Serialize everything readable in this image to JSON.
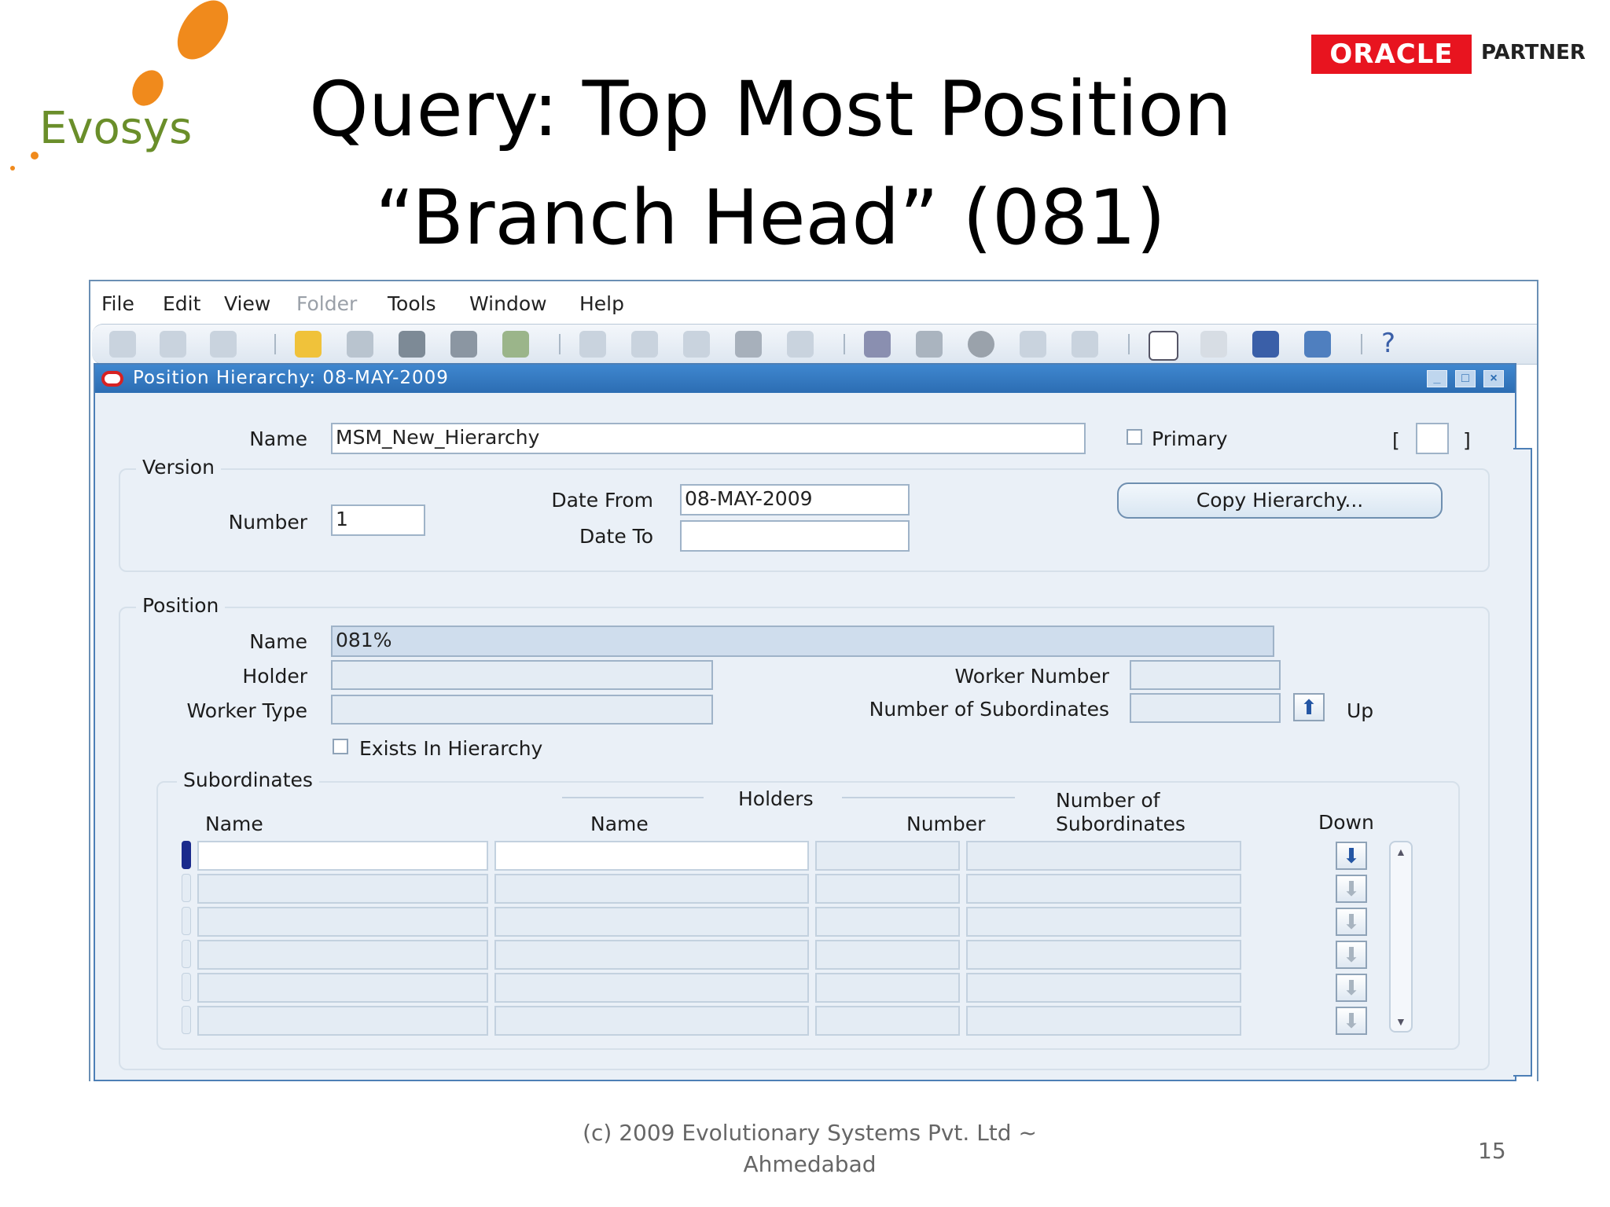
{
  "slide": {
    "title_line1": "Query: Top Most Position",
    "title_line2": "“Branch Head” (081)",
    "footer": "(c) 2009 Evolutionary Systems Pvt. Ltd ~ Ahmedabad",
    "page_number": "15",
    "logos": {
      "left": "Evosys",
      "right_brand": "ORACLE",
      "right_suffix": "PARTNER"
    }
  },
  "menu": [
    "File",
    "Edit",
    "View",
    "Folder",
    "Tools",
    "Window",
    "Help"
  ],
  "toolbar_icons": [
    "new-icon",
    "find-icon",
    "show-navigator-icon",
    "open-folder-icon",
    "save-icon",
    "next-step-icon",
    "print-icon",
    "close-form-icon",
    "cut-icon",
    "copy-icon",
    "paste-icon",
    "clear-record-icon",
    "delete-record-icon",
    "edit-field-icon",
    "zoom-icon",
    "translations-icon",
    "attachments-icon",
    "folder-tools-icon",
    "calendar-icon",
    "work-planner-icon",
    "window-export-icon",
    "help-docs-icon",
    "help-icon"
  ],
  "window": {
    "title": "Position Hierarchy: 08-MAY-2009",
    "name_label": "Name",
    "name_value": "MSM_New_Hierarchy",
    "primary_label": "Primary",
    "bracket_left": "[",
    "bracket_right": "]",
    "version": {
      "group_label": "Version",
      "number_label": "Number",
      "number_value": "1",
      "date_from_label": "Date From",
      "date_from_value": "08-MAY-2009",
      "date_to_label": "Date To",
      "date_to_value": "",
      "copy_button": "Copy Hierarchy..."
    },
    "position": {
      "group_label": "Position",
      "name_label": "Name",
      "name_value": "081%",
      "holder_label": "Holder",
      "worker_type_label": "Worker Type",
      "worker_number_label": "Worker Number",
      "num_subordinates_label": "Number of Subordinates",
      "up_label": "Up",
      "exists_label": "Exists In Hierarchy"
    },
    "subordinates": {
      "group_label": "Subordinates",
      "holders_header": "Holders",
      "col_name": "Name",
      "col_holder_name": "Name",
      "col_number": "Number",
      "col_num_sub_line1": "Number of",
      "col_num_sub_line2": "Subordinates",
      "col_down": "Down",
      "rows": [
        {
          "name": "",
          "holder_name": "",
          "number": "",
          "subordinates": ""
        },
        {
          "name": "",
          "holder_name": "",
          "number": "",
          "subordinates": ""
        },
        {
          "name": "",
          "holder_name": "",
          "number": "",
          "subordinates": ""
        },
        {
          "name": "",
          "holder_name": "",
          "number": "",
          "subordinates": ""
        },
        {
          "name": "",
          "holder_name": "",
          "number": "",
          "subordinates": ""
        },
        {
          "name": "",
          "holder_name": "",
          "number": "",
          "subordinates": ""
        }
      ]
    }
  },
  "colors": {
    "title_bar": "#2c6db3",
    "oracle_red": "#e8141f",
    "evosys_orange": "#f08a1c",
    "evosys_green": "#6a8e2a"
  }
}
